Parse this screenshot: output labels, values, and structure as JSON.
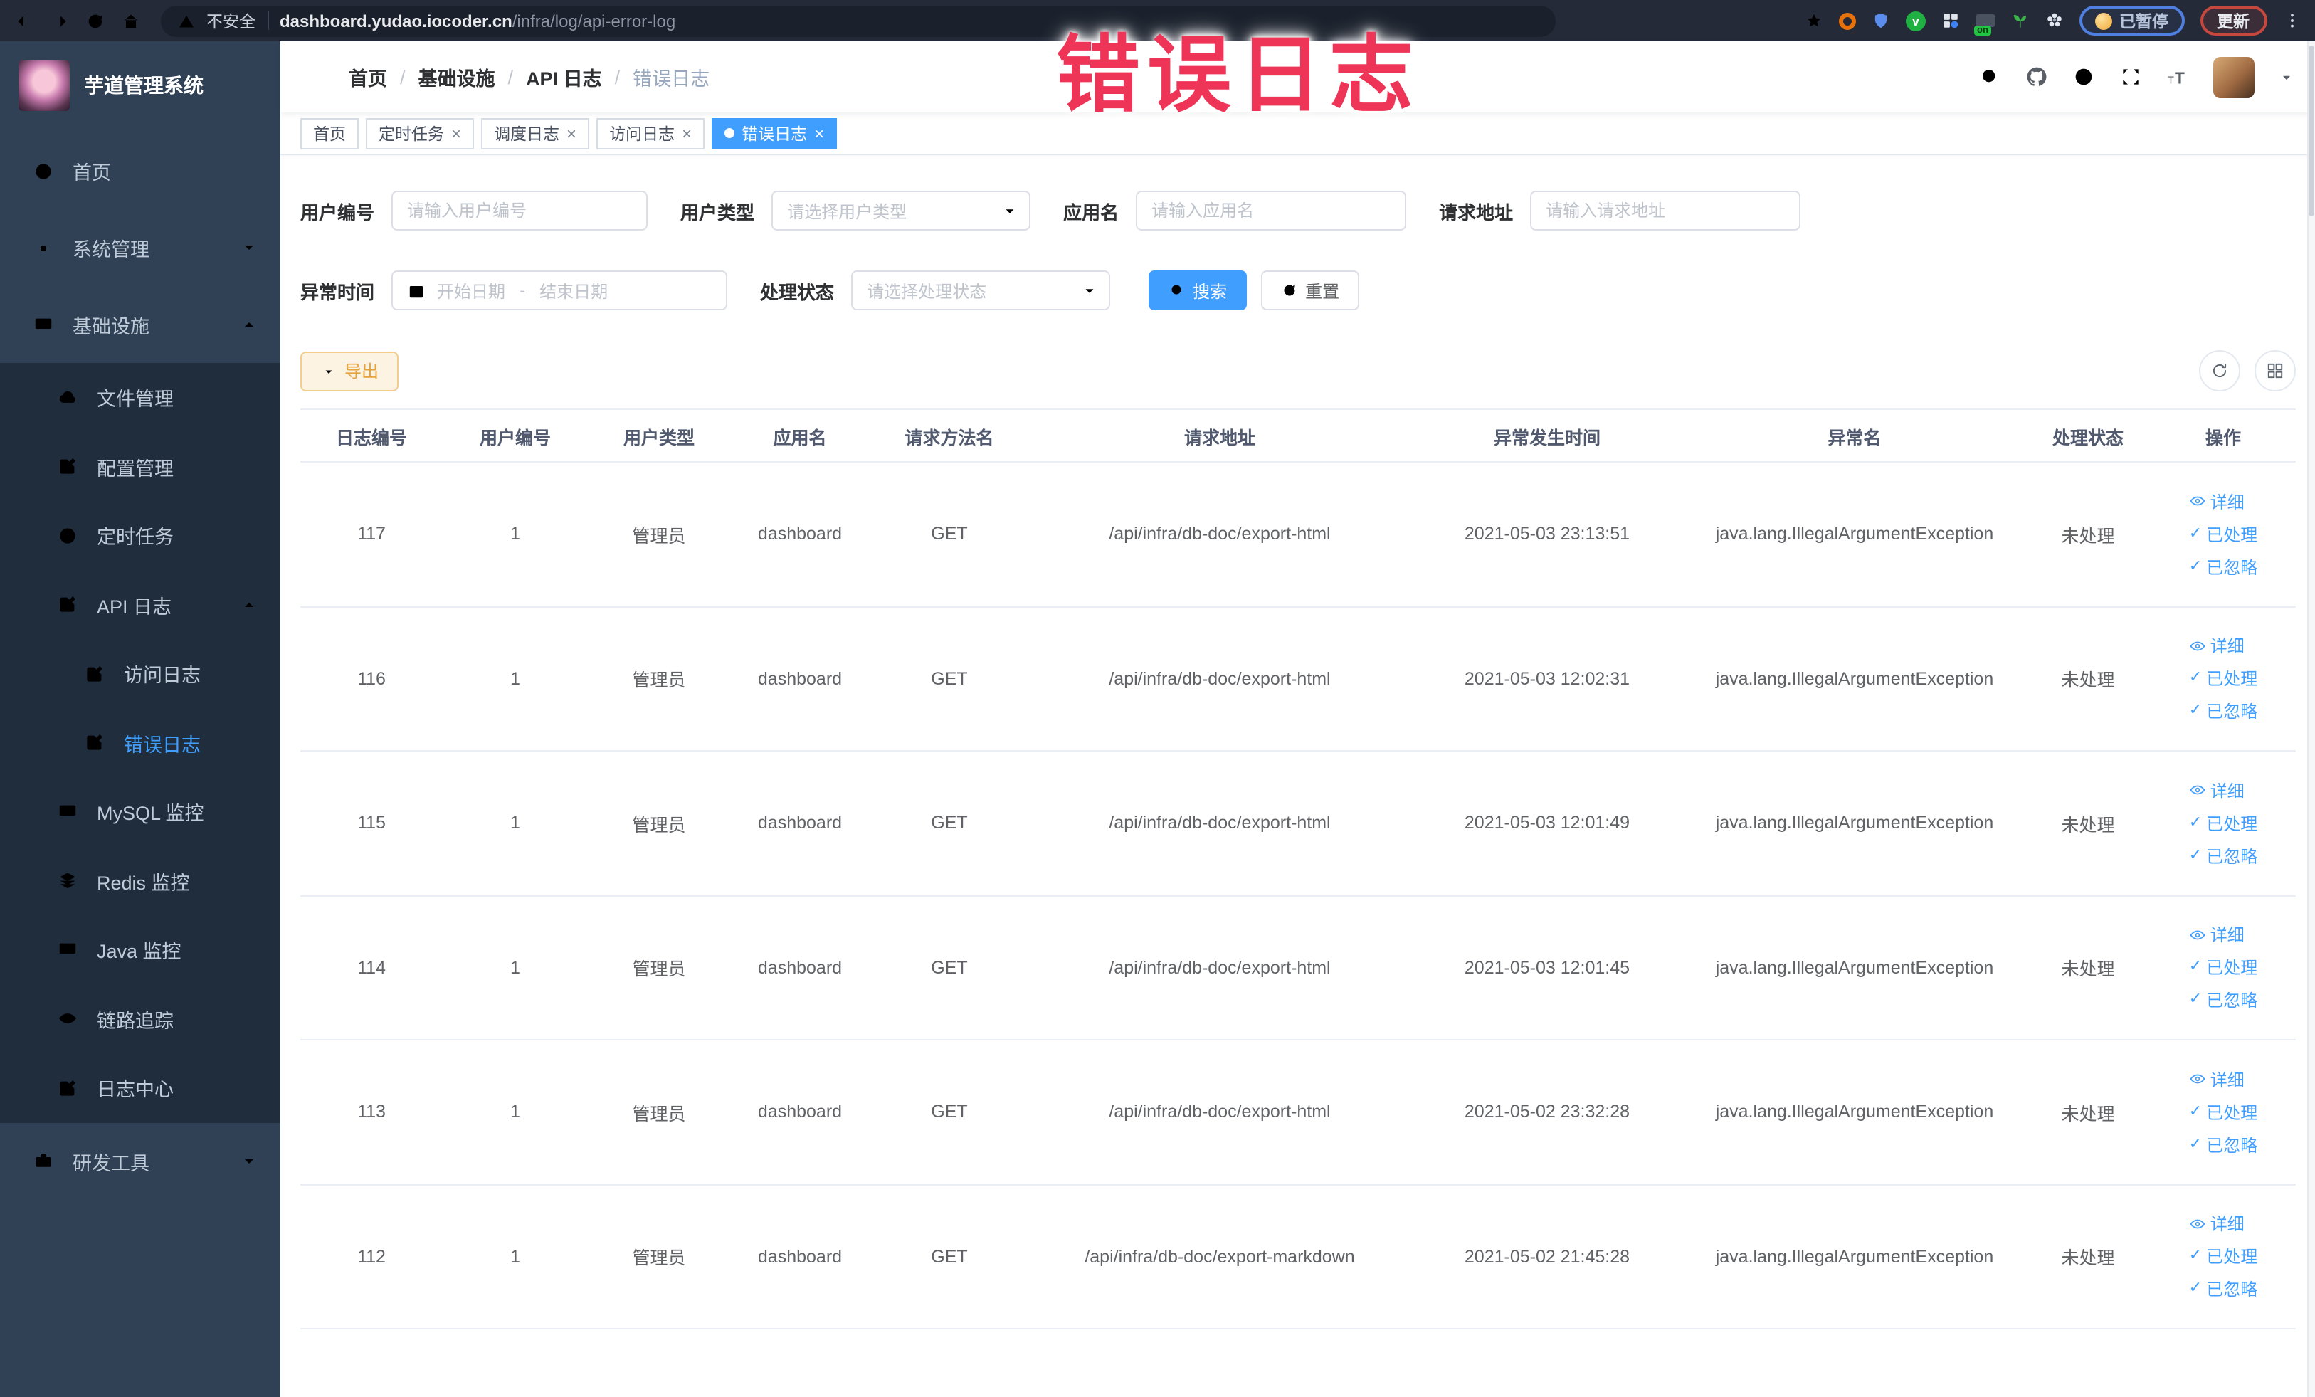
{
  "browser": {
    "security_label": "不安全",
    "url_host": "dashboard.yudao.iocoder.cn",
    "url_path": "/infra/log/api-error-log",
    "paused_label": "已暂停",
    "update_label": "更新"
  },
  "watermark": {
    "text": "错误日志"
  },
  "sidebar": {
    "title": "芋道管理系统",
    "items": [
      {
        "label": "首页"
      },
      {
        "label": "系统管理"
      },
      {
        "label": "基础设施"
      },
      {
        "label": "文件管理"
      },
      {
        "label": "配置管理"
      },
      {
        "label": "定时任务"
      },
      {
        "label": "API 日志"
      },
      {
        "label": "访问日志"
      },
      {
        "label": "错误日志"
      },
      {
        "label": "MySQL 监控"
      },
      {
        "label": "Redis 监控"
      },
      {
        "label": "Java 监控"
      },
      {
        "label": "链路追踪"
      },
      {
        "label": "日志中心"
      },
      {
        "label": "研发工具"
      }
    ]
  },
  "breadcrumb": {
    "items": [
      "首页",
      "基础设施",
      "API 日志",
      "错误日志"
    ]
  },
  "tabs": [
    {
      "label": "首页"
    },
    {
      "label": "定时任务"
    },
    {
      "label": "调度日志"
    },
    {
      "label": "访问日志"
    },
    {
      "label": "错误日志"
    }
  ],
  "filters": {
    "user_id_label": "用户编号",
    "user_id_ph": "请输入用户编号",
    "user_type_label": "用户类型",
    "user_type_ph": "请选择用户类型",
    "app_label": "应用名",
    "app_ph": "请输入应用名",
    "url_label": "请求地址",
    "url_ph": "请输入请求地址",
    "time_label": "异常时间",
    "time_start_ph": "开始日期",
    "time_sep": "-",
    "time_end_ph": "结束日期",
    "status_label": "处理状态",
    "status_ph": "请选择处理状态",
    "search_label": "搜索",
    "reset_label": "重置"
  },
  "toolbar": {
    "export_label": "导出"
  },
  "table": {
    "headers": [
      "日志编号",
      "用户编号",
      "用户类型",
      "应用名",
      "请求方法名",
      "请求地址",
      "异常发生时间",
      "异常名",
      "处理状态",
      "操作"
    ],
    "rows": [
      {
        "id": "117",
        "user_id": "1",
        "user_type": "管理员",
        "app": "dashboard",
        "method": "GET",
        "url": "/api/infra/db-doc/export-html",
        "time": "2021-05-03 23:13:51",
        "exception": "java.lang.IllegalArgumentException",
        "status": "未处理"
      },
      {
        "id": "116",
        "user_id": "1",
        "user_type": "管理员",
        "app": "dashboard",
        "method": "GET",
        "url": "/api/infra/db-doc/export-html",
        "time": "2021-05-03 12:02:31",
        "exception": "java.lang.IllegalArgumentException",
        "status": "未处理"
      },
      {
        "id": "115",
        "user_id": "1",
        "user_type": "管理员",
        "app": "dashboard",
        "method": "GET",
        "url": "/api/infra/db-doc/export-html",
        "time": "2021-05-03 12:01:49",
        "exception": "java.lang.IllegalArgumentException",
        "status": "未处理"
      },
      {
        "id": "114",
        "user_id": "1",
        "user_type": "管理员",
        "app": "dashboard",
        "method": "GET",
        "url": "/api/infra/db-doc/export-html",
        "time": "2021-05-03 12:01:45",
        "exception": "java.lang.IllegalArgumentException",
        "status": "未处理"
      },
      {
        "id": "113",
        "user_id": "1",
        "user_type": "管理员",
        "app": "dashboard",
        "method": "GET",
        "url": "/api/infra/db-doc/export-html",
        "time": "2021-05-02 23:32:28",
        "exception": "java.lang.IllegalArgumentException",
        "status": "未处理"
      },
      {
        "id": "112",
        "user_id": "1",
        "user_type": "管理员",
        "app": "dashboard",
        "method": "GET",
        "url": "/api/infra/db-doc/export-markdown",
        "time": "2021-05-02 21:45:28",
        "exception": "java.lang.IllegalArgumentException",
        "status": "未处理"
      }
    ]
  },
  "row_actions": {
    "detail": "详细",
    "processed": "已处理",
    "ignored": "已忽略"
  },
  "colors": {
    "accent": "#409eff",
    "active_tab": "#409eff",
    "warning": "#e6a23c",
    "watermark": "#ee3558",
    "sidebar_bg": "#304156",
    "submenu_bg": "#1f2d3d"
  }
}
